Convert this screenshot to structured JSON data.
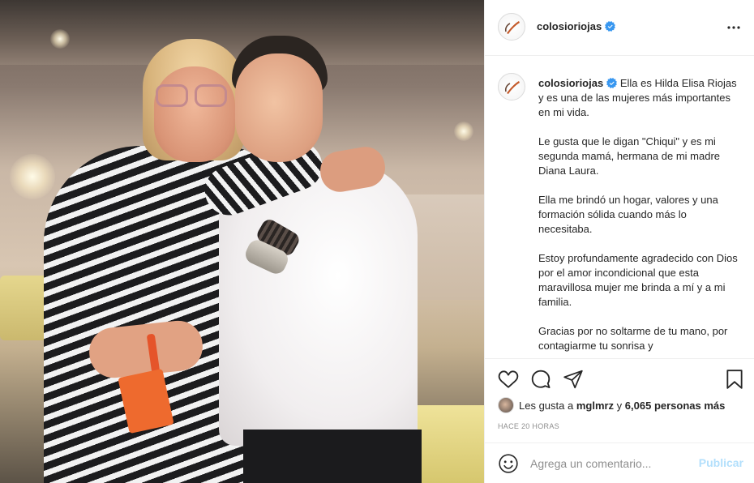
{
  "post": {
    "photo_alt": "Foto de la publicación"
  },
  "header": {
    "username": "colosioriojas",
    "verified_icon": "verified-badge-icon",
    "more_icon": "more-options-icon"
  },
  "caption": {
    "username": "colosioriojas",
    "paragraphs": [
      "Ella es Hilda Elisa Riojas y es una de las mujeres más importantes en mi vida.",
      "Le gusta que le digan \"Chiqui\" y es mi segunda mamá, hermana de mi madre Diana Laura.",
      "Ella me brindó un hogar, valores y una formación sólida cuando más lo necesitaba.",
      "Estoy profundamente agradecido con Dios por el amor incondicional que esta maravillosa mujer me brinda a mí y a mi familia.",
      "Gracias por no soltarme de tu mano, por contagiarme tu sonrisa y"
    ]
  },
  "actions": {
    "icons": [
      "heart-icon",
      "comment-icon",
      "share-icon",
      "bookmark-icon"
    ],
    "likes_prefix": "Les gusta a ",
    "likes_user": "mglmrz",
    "likes_middle": " y ",
    "likes_count": "6,065 personas más",
    "timestamp": "Hace 20 horas"
  },
  "comment": {
    "placeholder": "Agrega un comentario...",
    "post_label": "Publicar",
    "emoji_icon": "emoji-icon"
  },
  "colors": {
    "verified": "#3897f0",
    "post_disabled": "#b2dffc",
    "border": "#efefef",
    "text_secondary": "#8e8e8e"
  }
}
